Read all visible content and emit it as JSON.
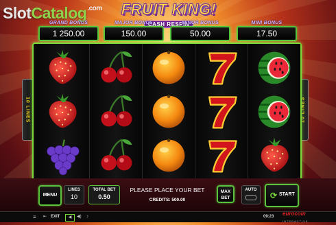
{
  "watermark": {
    "slot": "Slot",
    "catalog": "Catalog",
    "com": ".com"
  },
  "logo": {
    "title": "FRUIT KING!",
    "subtitle": "CASH RESPIN"
  },
  "jackpots": [
    {
      "label": "GRAND BONUS",
      "value": "1 250.00"
    },
    {
      "label": "MAJOR BONUS",
      "value": "150.00"
    },
    {
      "label": "MINOR BONUS",
      "value": "50.00"
    },
    {
      "label": "MINI BONUS",
      "value": "17.50"
    }
  ],
  "reels": [
    [
      "strawberry",
      "strawberry",
      "grapes"
    ],
    [
      "cherries",
      "cherries",
      "cherries"
    ],
    [
      "orange",
      "orange",
      "orange"
    ],
    [
      "seven",
      "seven",
      "seven"
    ],
    [
      "watermelon",
      "watermelon",
      "strawberry"
    ]
  ],
  "side_lines": {
    "left": "10 LINES",
    "right": "10 LINES"
  },
  "controls": {
    "menu": "MENU",
    "lines_label": "LINES",
    "lines_value": "10",
    "total_bet_label": "TOTAL BET",
    "total_bet_value": "0.50",
    "message": "PLEASE PLACE YOUR BET",
    "credits_label": "CREDITS:",
    "credits_value": "500.00",
    "max_bet": "MAX BET",
    "auto": "AUTO",
    "start": "START"
  },
  "statusbar": {
    "exit": "EXIT",
    "time": "09:23",
    "brand": "eurocoin",
    "brand_sub": "INTERACTIVE"
  },
  "colors": {
    "accent_green": "#5ac43c",
    "jackpot_label": "#c8b6ff",
    "lines_text": "#f0d020"
  }
}
